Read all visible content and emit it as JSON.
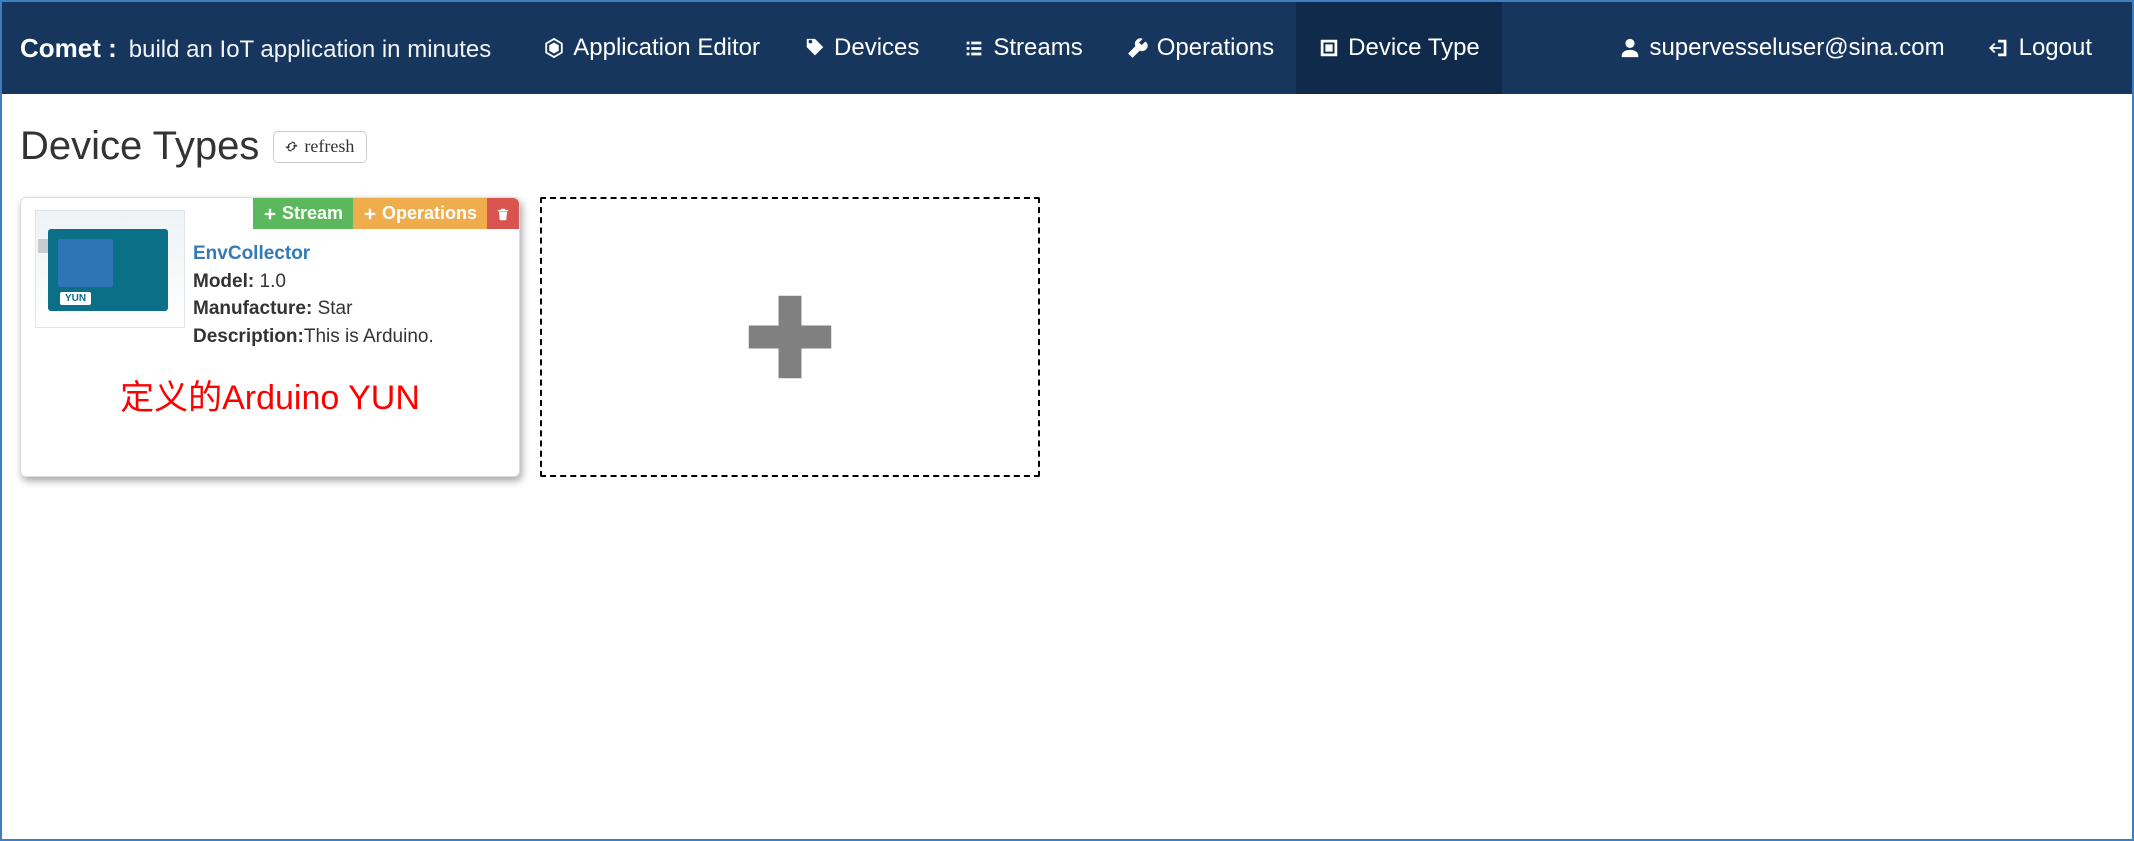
{
  "brand": {
    "name": "Comet :",
    "tagline": "build an IoT application in minutes"
  },
  "nav": {
    "items": [
      {
        "label": "Application Editor"
      },
      {
        "label": "Devices"
      },
      {
        "label": "Streams"
      },
      {
        "label": "Operations"
      },
      {
        "label": "Device Type"
      }
    ],
    "user": "supervesseluser@sina.com",
    "logout": "Logout"
  },
  "page": {
    "title": "Device Types",
    "refresh": "refresh"
  },
  "card": {
    "actions": {
      "stream": "Stream",
      "operations": "Operations"
    },
    "name": "EnvCollector",
    "model_label": "Model:",
    "model_value": "1.0",
    "manufacture_label": "Manufacture:",
    "manufacture_value": "Star",
    "description_label": "Description:",
    "description_value": "This is Arduino.",
    "caption": "定义的Arduino YUN"
  }
}
